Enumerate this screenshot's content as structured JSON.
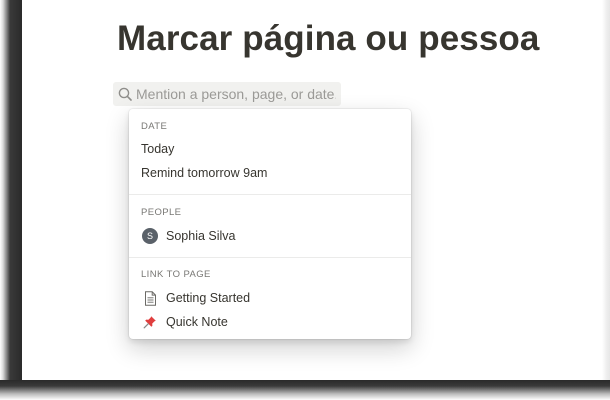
{
  "page": {
    "title": "Marcar página ou pessoa"
  },
  "mention_search": {
    "placeholder": "Mention a person, page, or date...",
    "icon": "search-icon"
  },
  "menu": {
    "sections": {
      "date": {
        "header": "DATE",
        "items": [
          "Today",
          "Remind tomorrow 9am"
        ]
      },
      "people": {
        "header": "PEOPLE",
        "person": {
          "name": "Sophia Silva",
          "avatar_initial": "S",
          "avatar_color": "#5a6169"
        }
      },
      "link_to_page": {
        "header": "LINK TO PAGE",
        "pages": [
          {
            "title": "Getting Started",
            "icon": "document-icon"
          },
          {
            "title": "Quick Note",
            "icon": "pushpin-icon",
            "icon_color": "#e03e3e"
          }
        ]
      }
    }
  },
  "colors": {
    "text": "#37352f",
    "muted": "#787774",
    "placeholder": "#9b9a97",
    "search_bg": "#f1f1ef"
  }
}
